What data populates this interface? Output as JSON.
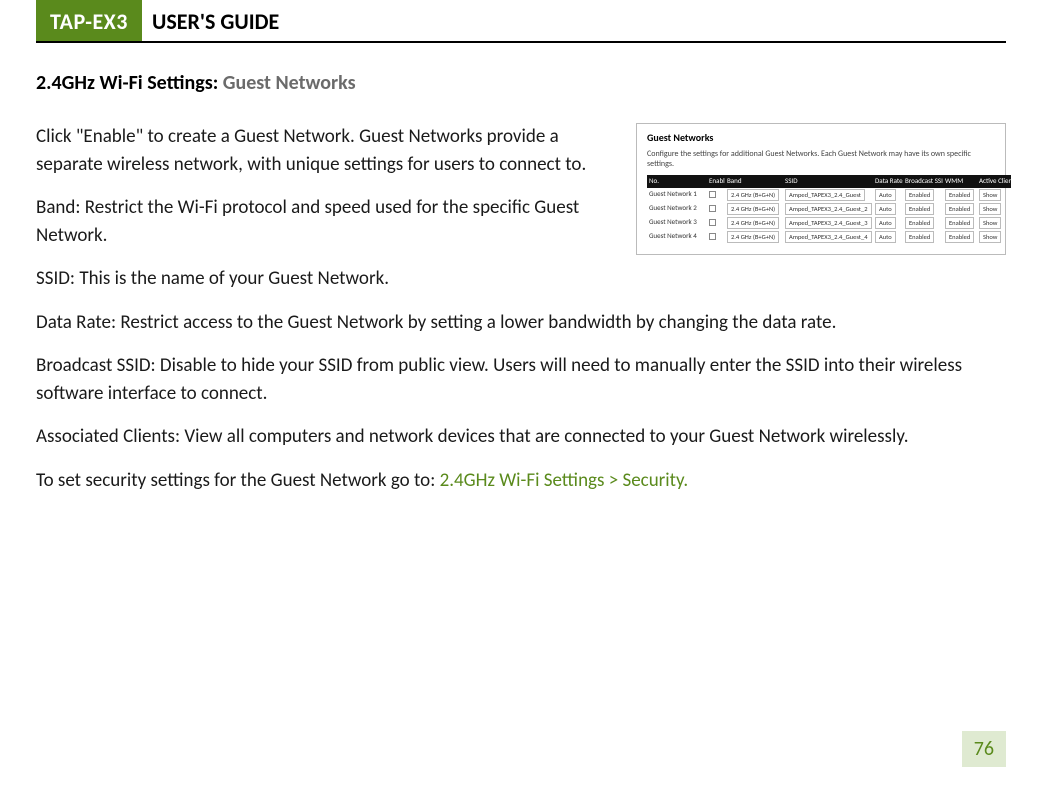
{
  "header": {
    "product": "TAP-EX3",
    "guide": "USER'S GUIDE"
  },
  "section": {
    "title_main": "2.4GHz Wi-Fi Settings:",
    "title_sub": "Guest Networks"
  },
  "paragraphs": {
    "intro": "Click \"Enable\" to create a Guest Network. Guest Networks provide a separate wireless network, with unique settings for users to connect to.",
    "band": "Band: Restrict the Wi-Fi protocol and speed used for the specific Guest Network.",
    "ssid": "SSID: This is the name of your Guest Network.",
    "datarate": "Data Rate: Restrict access to the Guest Network by setting a lower bandwidth by changing the data rate.",
    "broadcast": "Broadcast SSID: Disable to hide your SSID from public view. Users will need to manually enter the SSID into their wireless software interface to connect.",
    "assoc": "Associated Clients: View all computers and network devices that are connected to your Guest Network wirelessly.",
    "security_prefix": "To set security settings for the Guest Network go to: ",
    "security_link": "2.4GHz Wi-Fi Settings > Security."
  },
  "figure": {
    "title": "Guest Networks",
    "subtitle": "Configure the settings for additional Guest Networks. Each Guest Network may have its own specific settings.",
    "headers": [
      "No.",
      "Enable",
      "Band",
      "SSID",
      "Data Rate",
      "Broadcast SSID",
      "WMM",
      "Active Client List"
    ],
    "rows": [
      {
        "no": "Guest Network 1",
        "band": "2.4 GHz (B+G+N)",
        "ssid": "Amped_TAPEX3_2.4_Guest",
        "rate": "Auto",
        "bcast": "Enabled",
        "wmm": "Enabled",
        "clients": "Show"
      },
      {
        "no": "Guest Network 2",
        "band": "2.4 GHz (B+G+N)",
        "ssid": "Amped_TAPEX3_2.4_Guest_2",
        "rate": "Auto",
        "bcast": "Enabled",
        "wmm": "Enabled",
        "clients": "Show"
      },
      {
        "no": "Guest Network 3",
        "band": "2.4 GHz (B+G+N)",
        "ssid": "Amped_TAPEX3_2.4_Guest_3",
        "rate": "Auto",
        "bcast": "Enabled",
        "wmm": "Enabled",
        "clients": "Show"
      },
      {
        "no": "Guest Network 4",
        "band": "2.4 GHz (B+G+N)",
        "ssid": "Amped_TAPEX3_2.4_Guest_4",
        "rate": "Auto",
        "bcast": "Enabled",
        "wmm": "Enabled",
        "clients": "Show"
      }
    ]
  },
  "page_number": "76"
}
